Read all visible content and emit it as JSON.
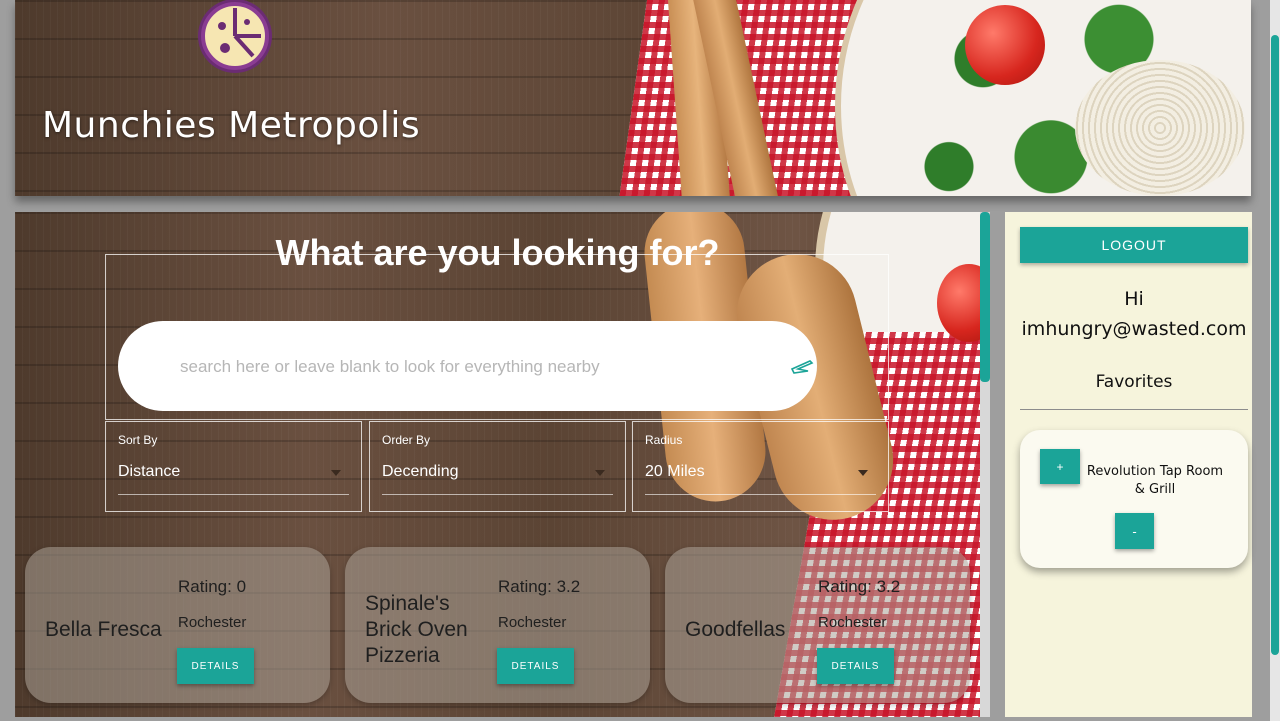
{
  "header": {
    "title": "Munchies Metropolis",
    "logo_icon": "pizza-logo-icon"
  },
  "search": {
    "heading": "What are you looking for?",
    "placeholder": "search here or leave blank to look for everything nearby",
    "value": "",
    "button_icon": "airplane-search-icon"
  },
  "filters": [
    {
      "label": "Sort By",
      "value": "Distance"
    },
    {
      "label": "Order By",
      "value": "Decending"
    },
    {
      "label": "Radius",
      "value": "20 Miles"
    }
  ],
  "results": [
    {
      "name": "Bella Fresca",
      "rating": "Rating: 0",
      "city": "Rochester",
      "button": "DETAILS"
    },
    {
      "name": "Spinale's Brick Oven Pizzeria",
      "rating": "Rating: 3.2",
      "city": "Rochester",
      "button": "DETAILS"
    },
    {
      "name": "Goodfellas",
      "rating": "Rating: 3.2",
      "city": "Rochester",
      "button": "DETAILS"
    }
  ],
  "sidebar": {
    "logout": "LOGOUT",
    "greeting": "Hi",
    "email": "imhungry@wasted.com",
    "favorites_title": "Favorites",
    "favorites": [
      {
        "add": "+",
        "name": "Revolution Tap Room & Grill",
        "remove": "-"
      }
    ]
  },
  "colors": {
    "accent": "#1ba498",
    "sidebar_bg": "#f6f4dc"
  }
}
